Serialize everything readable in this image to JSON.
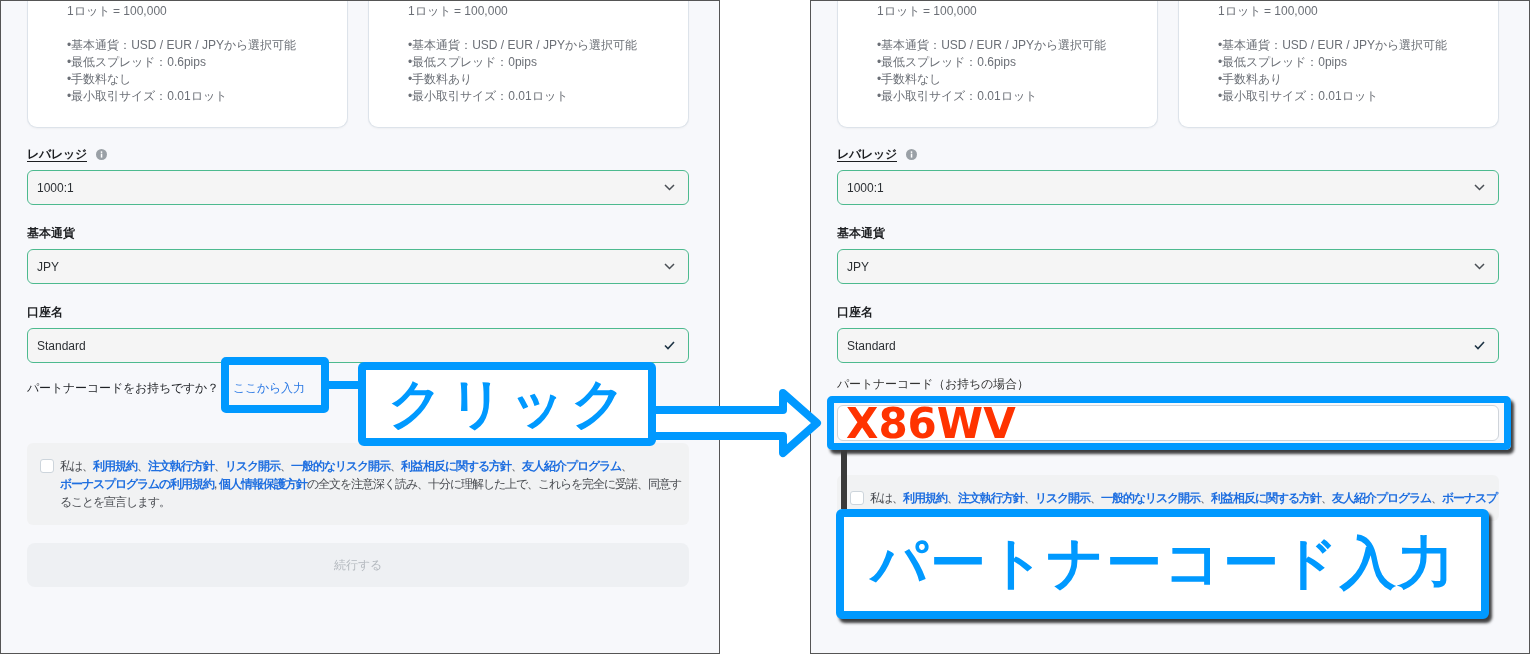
{
  "panels": [
    {
      "account_cards": [
        {
          "lot_size": "1ロット = 100,000",
          "features": [
            "•基本通貨：USD / EUR / JPYから選択可能",
            "•最低スプレッド：0.6pips",
            "•手数料なし",
            "•最小取引サイズ：0.01ロット"
          ]
        },
        {
          "lot_size": "1ロット = 100,000",
          "features": [
            "•基本通貨：USD / EUR / JPYから選択可能",
            "•最低スプレッド：0pips",
            "•手数料あり",
            "•最小取引サイズ：0.01ロット"
          ]
        }
      ],
      "fields": [
        {
          "kind": "select",
          "label": "レバレッジ",
          "info": true,
          "value": "1000:1"
        },
        {
          "kind": "select",
          "label": "基本通貨",
          "info": false,
          "value": "JPY"
        },
        {
          "kind": "text",
          "label": "口座名",
          "info": false,
          "value": "Standard",
          "valid": true
        }
      ],
      "partner_code": {
        "kind": "prompt",
        "text": "パートナーコードをお持ちですか？",
        "link": "ここから入力"
      },
      "consent": {
        "checked": false,
        "segments": [
          {
            "kind": "text",
            "text": "私は、"
          },
          {
            "kind": "link",
            "text": "利用規約"
          },
          {
            "kind": "text",
            "text": "、"
          },
          {
            "kind": "link",
            "text": "注文執行方針"
          },
          {
            "kind": "text",
            "text": "、"
          },
          {
            "kind": "link",
            "text": "リスク開示"
          },
          {
            "kind": "text",
            "text": "、"
          },
          {
            "kind": "link",
            "text": "一般的なリスク開示"
          },
          {
            "kind": "text",
            "text": "、"
          },
          {
            "kind": "link",
            "text": "利益相反に関する方針"
          },
          {
            "kind": "text",
            "text": "、"
          },
          {
            "kind": "link",
            "text": "友人紹介プログラム"
          },
          {
            "kind": "text",
            "text": "、"
          },
          {
            "kind": "link",
            "text": "ボーナスプログラムの利用規約"
          },
          {
            "kind": "text",
            "text": ", "
          },
          {
            "kind": "link",
            "text": "個人情報保護方針"
          },
          {
            "kind": "text",
            "text": "の全文を注意深く読み、十分に理解した上で、これらを完全に受諾、同意することを宣言します。"
          }
        ]
      },
      "continue_button": {
        "label": "続行する",
        "disabled": true
      },
      "annotation": {
        "kind": "link",
        "text": "クリック"
      }
    },
    {
      "account_cards": [
        {
          "lot_size": "1ロット = 100,000",
          "features": [
            "•基本通貨：USD / EUR / JPYから選択可能",
            "•最低スプレッド：0.6pips",
            "•手数料なし",
            "•最小取引サイズ：0.01ロット"
          ]
        },
        {
          "lot_size": "1ロット = 100,000",
          "features": [
            "•基本通貨：USD / EUR / JPYから選択可能",
            "•最低スプレッド：0pips",
            "•手数料あり",
            "•最小取引サイズ：0.01ロット"
          ]
        }
      ],
      "fields": [
        {
          "kind": "select",
          "label": "レバレッジ",
          "info": true,
          "value": "1000:1"
        },
        {
          "kind": "select",
          "label": "基本通貨",
          "info": false,
          "value": "JPY"
        },
        {
          "kind": "text",
          "label": "口座名",
          "info": false,
          "value": "Standard",
          "valid": true
        }
      ],
      "partner_code": {
        "kind": "field",
        "label": "パートナーコード（お持ちの場合）",
        "value": "X86WV"
      },
      "consent": {
        "checked": false,
        "segments": [
          {
            "kind": "text",
            "text": "私は、"
          },
          {
            "kind": "link",
            "text": "利用規約"
          },
          {
            "kind": "text",
            "text": "、"
          },
          {
            "kind": "link",
            "text": "注文執行方針"
          },
          {
            "kind": "text",
            "text": "、"
          },
          {
            "kind": "link",
            "text": "リスク開示"
          },
          {
            "kind": "text",
            "text": "、"
          },
          {
            "kind": "link",
            "text": "一般的なリスク開示"
          },
          {
            "kind": "text",
            "text": "、"
          },
          {
            "kind": "link",
            "text": "利益相反に関する方針"
          },
          {
            "kind": "text",
            "text": "、"
          },
          {
            "kind": "link",
            "text": "友人紹介プログラム"
          },
          {
            "kind": "text",
            "text": "、"
          },
          {
            "kind": "link",
            "text": "ボーナスプ"
          }
        ]
      },
      "annotation": {
        "kind": "field",
        "text": "パートナーコード入力"
      }
    }
  ]
}
